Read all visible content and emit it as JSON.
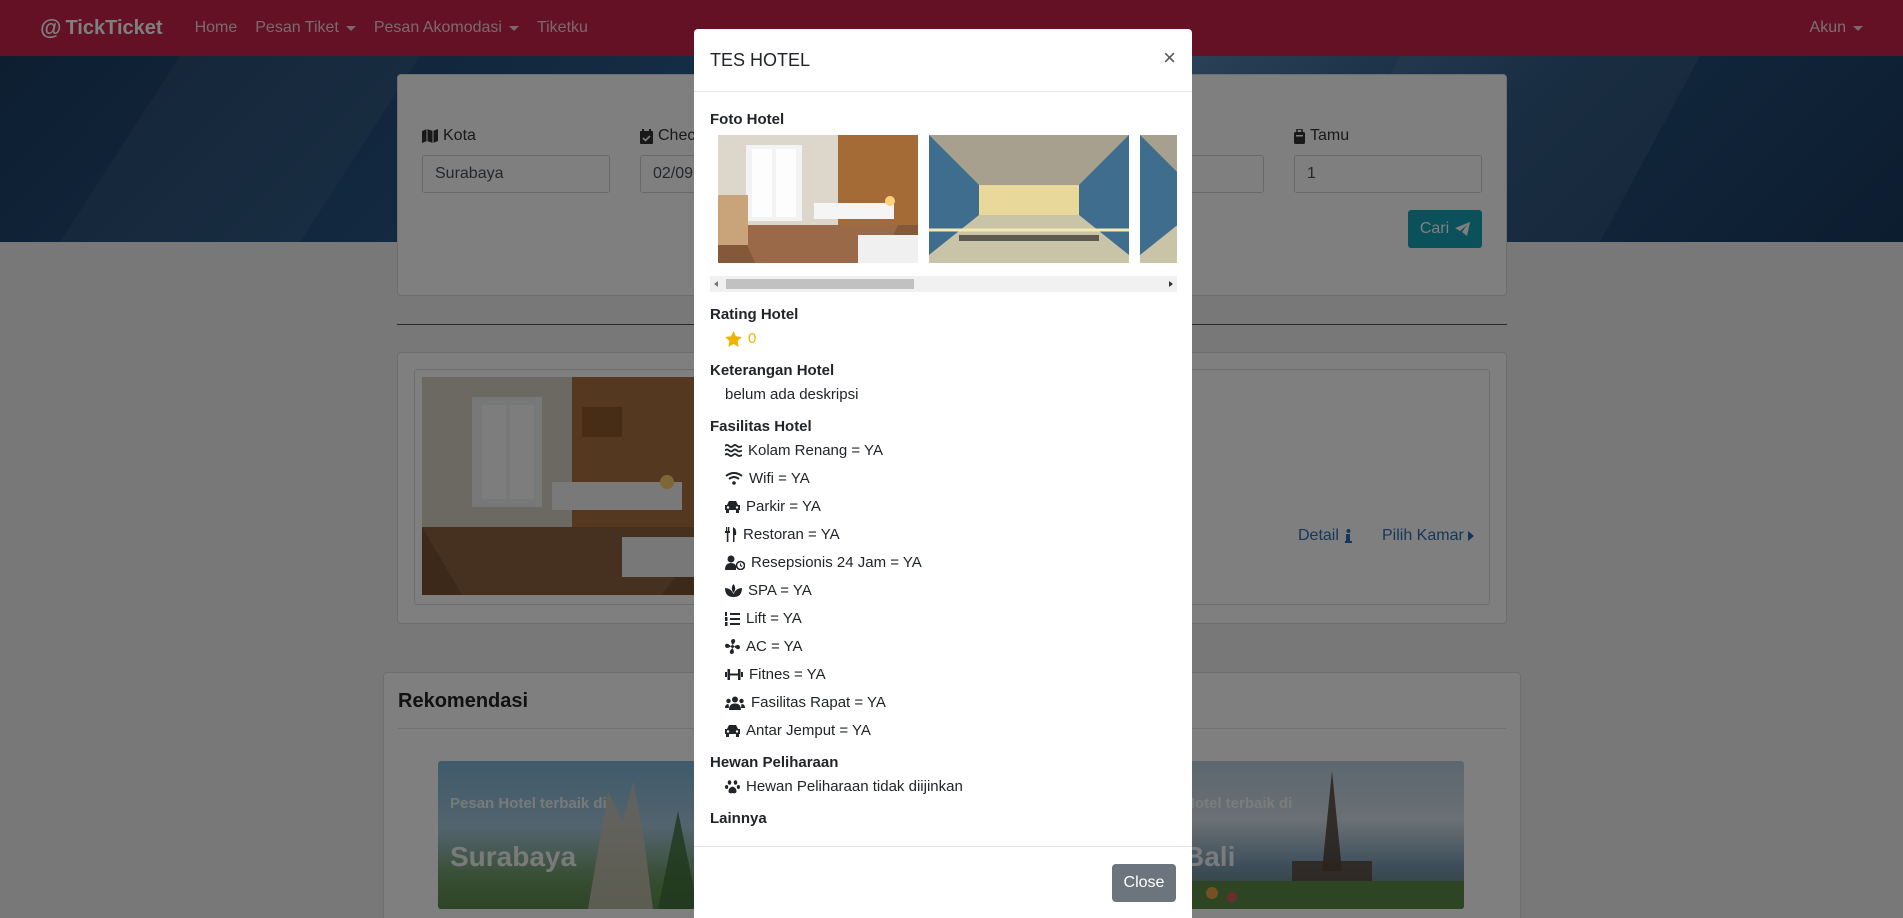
{
  "navbar": {
    "brand": "TickTicket",
    "links": [
      "Home",
      "Pesan Tiket",
      "Pesan Akomodasi",
      "Tiketku"
    ],
    "account": "Akun"
  },
  "search": {
    "kota_label": "Kota",
    "kota_value": "Surabaya",
    "checkin_label": "Check",
    "checkin_value": "02/09",
    "tamu_label": "Tamu",
    "tamu_value": "1",
    "cari_label": "Cari"
  },
  "result": {
    "detail_label": "Detail",
    "pilih_label": "Pilih Kamar"
  },
  "rekomendasi": {
    "title": "Rekomendasi",
    "tiles": [
      {
        "subtitle": "Pesan Hotel terbaik di",
        "city": "Surabaya"
      },
      {
        "subtitle": "Hotel terbaik di",
        "city": "Bali"
      }
    ]
  },
  "modal": {
    "title": "TES HOTEL",
    "foto_label": "Foto Hotel",
    "rating_label": "Rating Hotel",
    "rating_value": "0",
    "keterangan_label": "Keterangan Hotel",
    "keterangan_value": "belum ada deskripsi",
    "fasilitas_label": "Fasilitas Hotel",
    "fasilitas": [
      {
        "icon": "water-icon",
        "text": "Kolam Renang = YA"
      },
      {
        "icon": "wifi-icon",
        "text": "Wifi = YA"
      },
      {
        "icon": "car-icon",
        "text": "Parkir = YA"
      },
      {
        "icon": "utensils-icon",
        "text": "Restoran = YA"
      },
      {
        "icon": "user-clock-icon",
        "text": "Resepsionis 24 Jam = YA"
      },
      {
        "icon": "spa-icon",
        "text": "SPA = YA"
      },
      {
        "icon": "list-ol-icon",
        "text": "Lift = YA"
      },
      {
        "icon": "fan-icon",
        "text": "AC = YA"
      },
      {
        "icon": "dumbbell-icon",
        "text": "Fitnes = YA"
      },
      {
        "icon": "users-icon",
        "text": "Fasilitas Rapat = YA"
      },
      {
        "icon": "car-icon",
        "text": "Antar Jemput = YA"
      }
    ],
    "hewan_label": "Hewan Peliharaan",
    "hewan_value": "Hewan Peliharaan tidak diijinkan",
    "lainnya_label": "Lainnya",
    "close_label": "Close"
  },
  "colors": {
    "navbar": "#c8234a",
    "cari_button": "#17a2b8",
    "close_button": "#6c757d",
    "star": "#f0b400",
    "link": "#2a6fb8"
  }
}
